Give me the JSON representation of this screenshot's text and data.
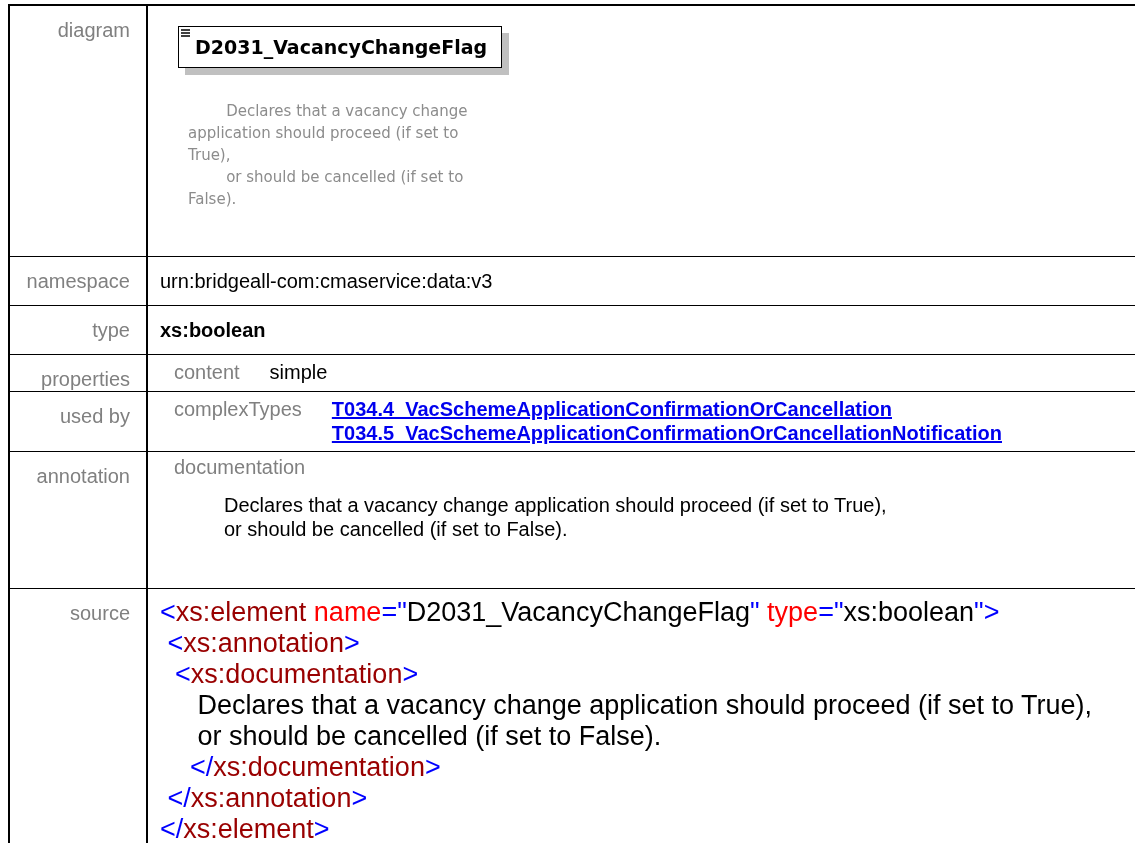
{
  "rows": [
    {
      "kind": "diagram",
      "label": "diagram",
      "element_name": "D2031_VacancyChangeFlag",
      "doc": "        Declares that a vacancy change\napplication should proceed (if set to\nTrue),\n        or should be cancelled (if set to\nFalse)."
    },
    {
      "kind": "plain",
      "label": "namespace",
      "value": "urn:bridgeall-com:cmaservice:data:v3"
    },
    {
      "kind": "bold",
      "label": "type",
      "value": "xs:boolean"
    },
    {
      "kind": "pairs",
      "label": "properties",
      "key": "content",
      "values": [
        "simple"
      ]
    },
    {
      "kind": "links",
      "label": "used by",
      "key": "complexTypes",
      "values": [
        "T034.4_VacSchemeApplicationConfirmationOrCancellation",
        "T034.5_VacSchemeApplicationConfirmationOrCancellationNotification"
      ]
    },
    {
      "kind": "annotation",
      "label": "annotation",
      "key": "documentation",
      "value": "Declares that a vacancy change application should proceed (if set to True),\nor should be cancelled (if set to False)."
    },
    {
      "kind": "source",
      "label": "source",
      "lines": [
        [
          {
            "kind": "punct",
            "text": "<"
          },
          {
            "kind": "tag",
            "text": "xs:element"
          },
          {
            "kind": "attr",
            "text": " name"
          },
          {
            "kind": "punct",
            "text": "=\""
          },
          {
            "kind": "text",
            "text": "D2031_VacancyChangeFlag"
          },
          {
            "kind": "punct",
            "text": "\""
          },
          {
            "kind": "attr",
            "text": " type"
          },
          {
            "kind": "punct",
            "text": "=\""
          },
          {
            "kind": "text",
            "text": "xs:boolean"
          },
          {
            "kind": "punct",
            "text": "\">"
          }
        ],
        [
          {
            "kind": "punct",
            "text": " <"
          },
          {
            "kind": "tag",
            "text": "xs:annotation"
          },
          {
            "kind": "punct",
            "text": ">"
          }
        ],
        [
          {
            "kind": "punct",
            "text": "  <"
          },
          {
            "kind": "tag",
            "text": "xs:documentation"
          },
          {
            "kind": "punct",
            "text": ">"
          }
        ],
        [
          {
            "kind": "text",
            "text": "     Declares that a vacancy change application should proceed (if set to True),"
          }
        ],
        [
          {
            "kind": "text",
            "text": "     or should be cancelled (if set to False)."
          }
        ],
        [
          {
            "kind": "punct",
            "text": "    </"
          },
          {
            "kind": "tag",
            "text": "xs:documentation"
          },
          {
            "kind": "punct",
            "text": ">"
          }
        ],
        [
          {
            "kind": "punct",
            "text": " </"
          },
          {
            "kind": "tag",
            "text": "xs:annotation"
          },
          {
            "kind": "punct",
            "text": ">"
          }
        ],
        [
          {
            "kind": "punct",
            "text": "</"
          },
          {
            "kind": "tag",
            "text": "xs:element"
          },
          {
            "kind": "punct",
            "text": ">"
          }
        ]
      ]
    }
  ]
}
